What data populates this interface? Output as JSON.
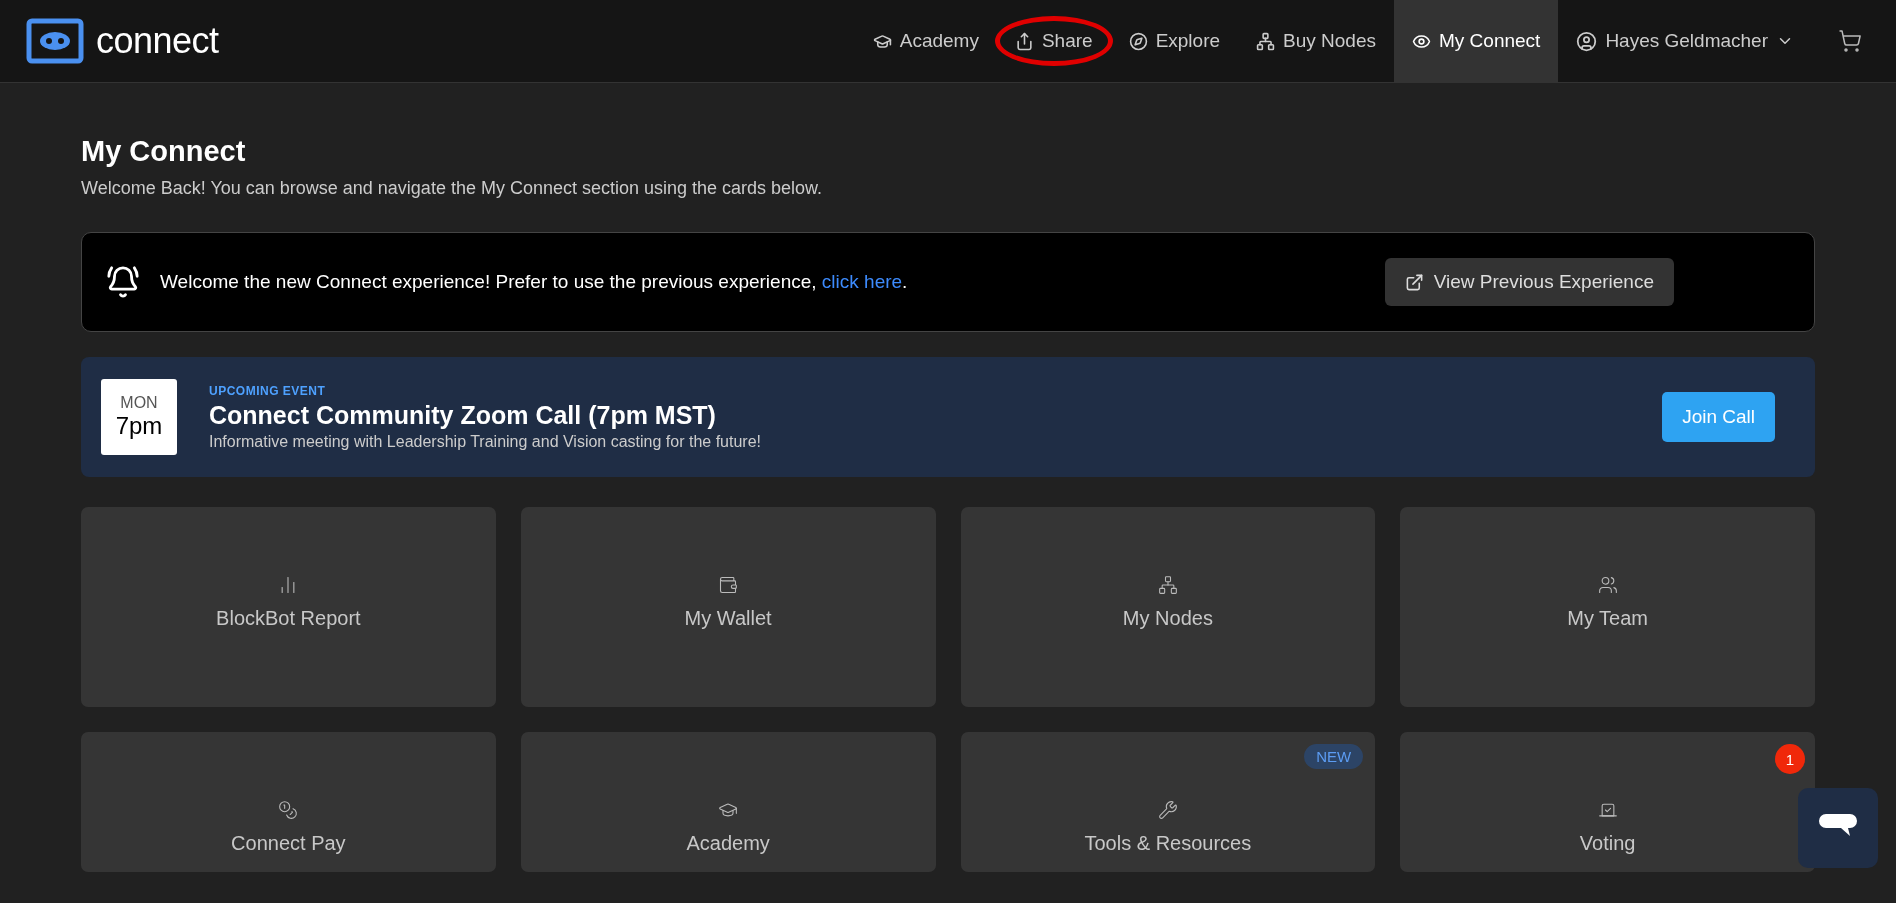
{
  "logo": {
    "text": "connect"
  },
  "nav": [
    {
      "label": "Academy",
      "selected": false,
      "circled": false
    },
    {
      "label": "Share",
      "selected": false,
      "circled": true
    },
    {
      "label": "Explore",
      "selected": false,
      "circled": false
    },
    {
      "label": "Buy Nodes",
      "selected": false,
      "circled": false
    },
    {
      "label": "My Connect",
      "selected": true,
      "circled": false
    }
  ],
  "user": {
    "name": "Hayes Geldmacher"
  },
  "page": {
    "title": "My Connect",
    "subtitle": "Welcome Back! You can browse and navigate the My Connect section using the cards below."
  },
  "notice": {
    "text": "Welcome the new Connect experience! Prefer to use the previous experience, ",
    "link": "click here",
    "after": ".",
    "button": "View Previous Experience"
  },
  "event": {
    "day": "MON",
    "time": "7pm",
    "label": "UPCOMING EVENT",
    "title": "Connect Community Zoom Call (7pm MST)",
    "description": "Informative meeting with Leadership Training and Vision casting for the future!",
    "button": "Join Call"
  },
  "cards": [
    {
      "label": "BlockBot Report"
    },
    {
      "label": "My Wallet"
    },
    {
      "label": "My Nodes"
    },
    {
      "label": "My Team"
    },
    {
      "label": "Connect Pay"
    },
    {
      "label": "Academy"
    },
    {
      "label": "Tools & Resources",
      "badge": "NEW"
    },
    {
      "label": "Voting",
      "count": "1"
    }
  ]
}
